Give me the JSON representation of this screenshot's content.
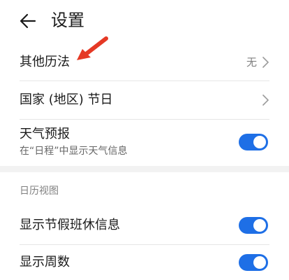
{
  "header": {
    "title": "设置",
    "back_icon": "arrow-left-icon"
  },
  "rows": {
    "other_calendar": {
      "label": "其他历法",
      "value": "无"
    },
    "holidays": {
      "label": "国家 (地区) 节日"
    },
    "weather": {
      "label": "天气预报",
      "subtitle": "在“日程”中显示天气信息",
      "enabled": true
    }
  },
  "calendar_view": {
    "section_title": "日历视图",
    "show_holiday_info": {
      "label": "显示节假班休信息",
      "enabled": true
    },
    "show_week_number": {
      "label": "显示周数",
      "enabled": true
    }
  },
  "colors": {
    "accent": "#1e6fe6",
    "annotation_arrow": "#e53925",
    "section_gap": "#f2f2f2"
  }
}
